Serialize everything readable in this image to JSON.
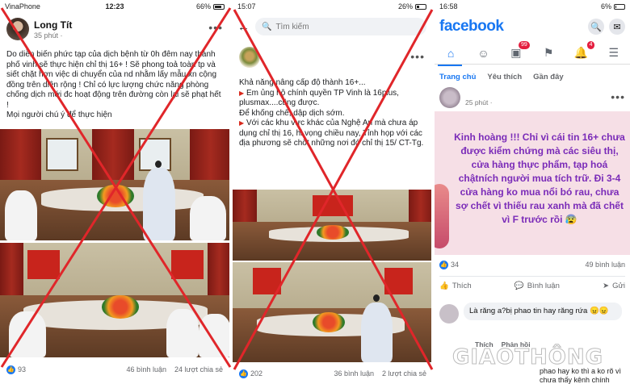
{
  "panel1": {
    "status": {
      "carrier": "VinaPhone",
      "time": "12:23",
      "battery": "66%"
    },
    "author": "Long Tít",
    "time_ago": "35 phút ·",
    "post_text": "Do diễn biến phức tạp của dịch bệnh từ 0h đêm nay thành phố vinh sẽ thực hiện chỉ thị 16+ ! Sẽ phong toả toàn tp và siết chặt hơn việc di chuyển của nd nhằm lấy mẫu xn cộng đồng trên diện rộng ! Chỉ có lực lượng chức năng phòng chống dịch mới đc hoạt động trên đường còn lại sẽ phạt hết !",
    "post_text_2": "Mọi người chú ý để thực hiện",
    "likes": "93",
    "comments": "46 bình luận",
    "shares": "24 lượt chia sẻ"
  },
  "panel2": {
    "status": {
      "time": "15:07",
      "battery": "26%"
    },
    "search_placeholder": "Tìm kiếm",
    "lines": [
      "Khả năng nâng cấp độ thành 16+...",
      "Em ủng hộ chính quyền TP Vinh là 16plus, plusmax....cũng được.",
      "Để khống chế, dập dịch sớm.",
      "Với các khu vực khác của Nghệ An mà chưa áp dụng chỉ thị 16, hi vọng chiều nay, Tỉnh họp với các địa phương sẽ chốt những nơi đó chỉ thị 15/ CT-Tg."
    ],
    "likes": "202",
    "comments": "36 bình luận",
    "shares": "2 lượt chia sẻ"
  },
  "panel3": {
    "status": {
      "time": "16:58",
      "battery": "6%"
    },
    "logo": "facebook",
    "badges": {
      "watch": "99",
      "notifications": "4"
    },
    "tabs": [
      "Trang chủ",
      "Yêu thích",
      "Gần đây"
    ],
    "time_ago": "25 phút ·",
    "card_text": "Kinh hoàng !!! Chỉ vì cái tin 16+ chưa được kiểm chứng mà các siêu thị, cửa hàng thực phẩm, tạp hoá chậtních người mua tích trữ. Đi 3-4 cửa hàng ko mua nổi bó rau, chưa sợ chết vì thiếu rau xanh mà đã chết vì F trước rồi 😰",
    "reactions": "34",
    "comments": "49 bình luận",
    "actions": {
      "like": "Thích",
      "comment": "Bình luận",
      "send": "Gửi"
    },
    "comment_text": "Là răng a?bị phao tin hay răng rứa 😠😠",
    "comment_actions": [
      "Thích",
      "Phản hồi"
    ],
    "reply_text": "phao hay ko thì a ko rõ vì chưa thấy kênh chính thống"
  },
  "watermark": "GIAOTHÔNG",
  "colors": {
    "fb_blue": "#1877f2",
    "cross_red": "#e0262a",
    "card_pink": "#f6dfe6",
    "card_text": "#7a2bb8"
  },
  "icons": [
    "back-arrow-icon",
    "search-icon",
    "more-icon",
    "home-icon",
    "groups-icon",
    "watch-icon",
    "flag-icon",
    "bell-icon",
    "menu-icon",
    "messenger-icon",
    "like-icon",
    "comment-icon",
    "send-icon"
  ]
}
